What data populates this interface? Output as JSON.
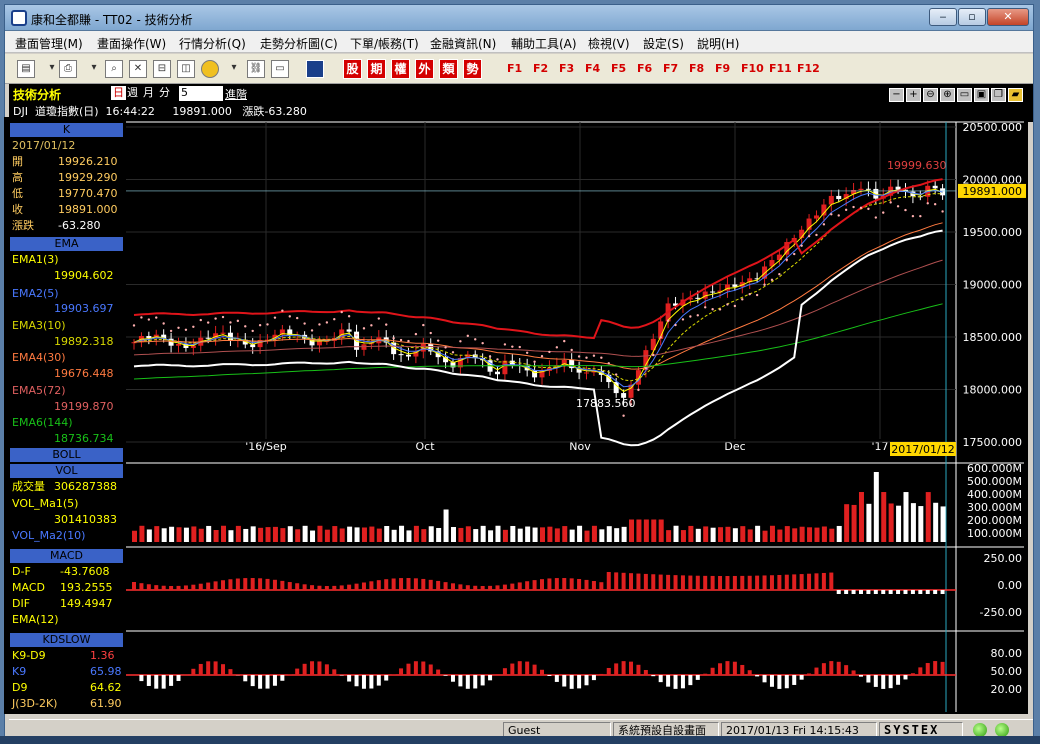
{
  "window": {
    "title": "康和全都賺 - TT02 - 技術分析",
    "buttons": [
      "‒",
      "▫",
      "✕"
    ]
  },
  "menu": [
    "畫面管理(M)",
    "畫面操作(W)",
    "行情分析(Q)",
    "走勢分析圖(C)",
    "下單/帳務(T)",
    "金融資訊(N)",
    "輔助工具(A)",
    "檢視(V)",
    "設定(S)",
    "說明(H)"
  ],
  "toolbar": {
    "tiles": [
      "股",
      "期",
      "權",
      "外",
      "類",
      "勢"
    ],
    "fkeys": [
      "F1",
      "F2",
      "F3",
      "F4",
      "F5",
      "F6",
      "F7",
      "F8",
      "F9",
      "F10",
      "F11",
      "F12"
    ]
  },
  "panel": {
    "title": "技術分析",
    "periods": [
      "日",
      "週",
      "月",
      "分"
    ],
    "period_value": "5",
    "advanced": "進階",
    "quote": "DJI  道瓊指數(日)  16:44:22     19891.000   漲跌-63.280"
  },
  "colors": {
    "up": "#e02020",
    "down": "#ffffff",
    "bb": "#e0141a",
    "ema1": "#ffff00",
    "ema2": "#4a78ff",
    "ema3": "#d8d800",
    "ema4": "#ff7a40",
    "ema5": "#b05050",
    "ema6": "#18c018",
    "grid": "#2a2a2a"
  },
  "side": {
    "k": {
      "header": "K",
      "date": "2017/01/12",
      "rows": [
        [
          "開",
          "19926.210"
        ],
        [
          "高",
          "19929.290"
        ],
        [
          "低",
          "19770.470"
        ],
        [
          "收",
          "19891.000"
        ],
        [
          "漲跌",
          "-63.280"
        ]
      ]
    },
    "ema": {
      "header": "EMA",
      "rows": [
        [
          "EMA1(3)",
          "19904.602"
        ],
        [
          "EMA2(5)",
          "19903.697"
        ],
        [
          "EMA3(10)",
          "19892.318"
        ],
        [
          "EMA4(30)",
          "19676.448"
        ],
        [
          "EMA5(72)",
          "19199.870"
        ],
        [
          "EMA6(144)",
          "18736.734"
        ]
      ]
    },
    "boll": {
      "header": "BOLL"
    },
    "vol": {
      "header": "VOL",
      "rows": [
        [
          "成交量",
          "306287388"
        ],
        [
          "VOL_Ma1(5)",
          ""
        ],
        [
          "",
          "301410383"
        ],
        [
          "VOL_Ma2(10)",
          ""
        ]
      ]
    },
    "macd": {
      "header": "MACD",
      "rows": [
        [
          "D-F",
          "-43.7608"
        ],
        [
          "MACD",
          "193.2555"
        ],
        [
          "DIF",
          "149.4947"
        ],
        [
          "EMA(12)",
          ""
        ]
      ]
    },
    "kd": {
      "header": "KDSLOW",
      "rows": [
        [
          "K9-D9",
          "1.36"
        ],
        [
          "K9",
          "65.98"
        ],
        [
          "D9",
          "64.62"
        ],
        [
          "J(3D-2K)",
          "61.90"
        ]
      ]
    }
  },
  "axes": {
    "price": [
      "20500.000",
      "20000.000",
      "19500.000",
      "19000.000",
      "18500.000",
      "18000.000",
      "17500.000"
    ],
    "price_current": "19891.000",
    "vol": [
      "600.000M",
      "500.000M",
      "400.000M",
      "300.000M",
      "200.000M",
      "100.000M"
    ],
    "macd": [
      "250.00",
      "0.00",
      "-250.00"
    ],
    "kd": [
      "80.00",
      "50.00",
      "20.00"
    ],
    "months": [
      "'16/Sep",
      "Oct",
      "Nov",
      "Dec",
      "'17"
    ],
    "date_cursor": "2017/01/12",
    "annot_high": "19999.630",
    "annot_low": "17883.560"
  },
  "status": {
    "user": "Guest",
    "layout": "系統預設自設畫面",
    "datetime": "2017/01/13 Fri 14:15:43",
    "brand": "SYSTEX"
  }
}
